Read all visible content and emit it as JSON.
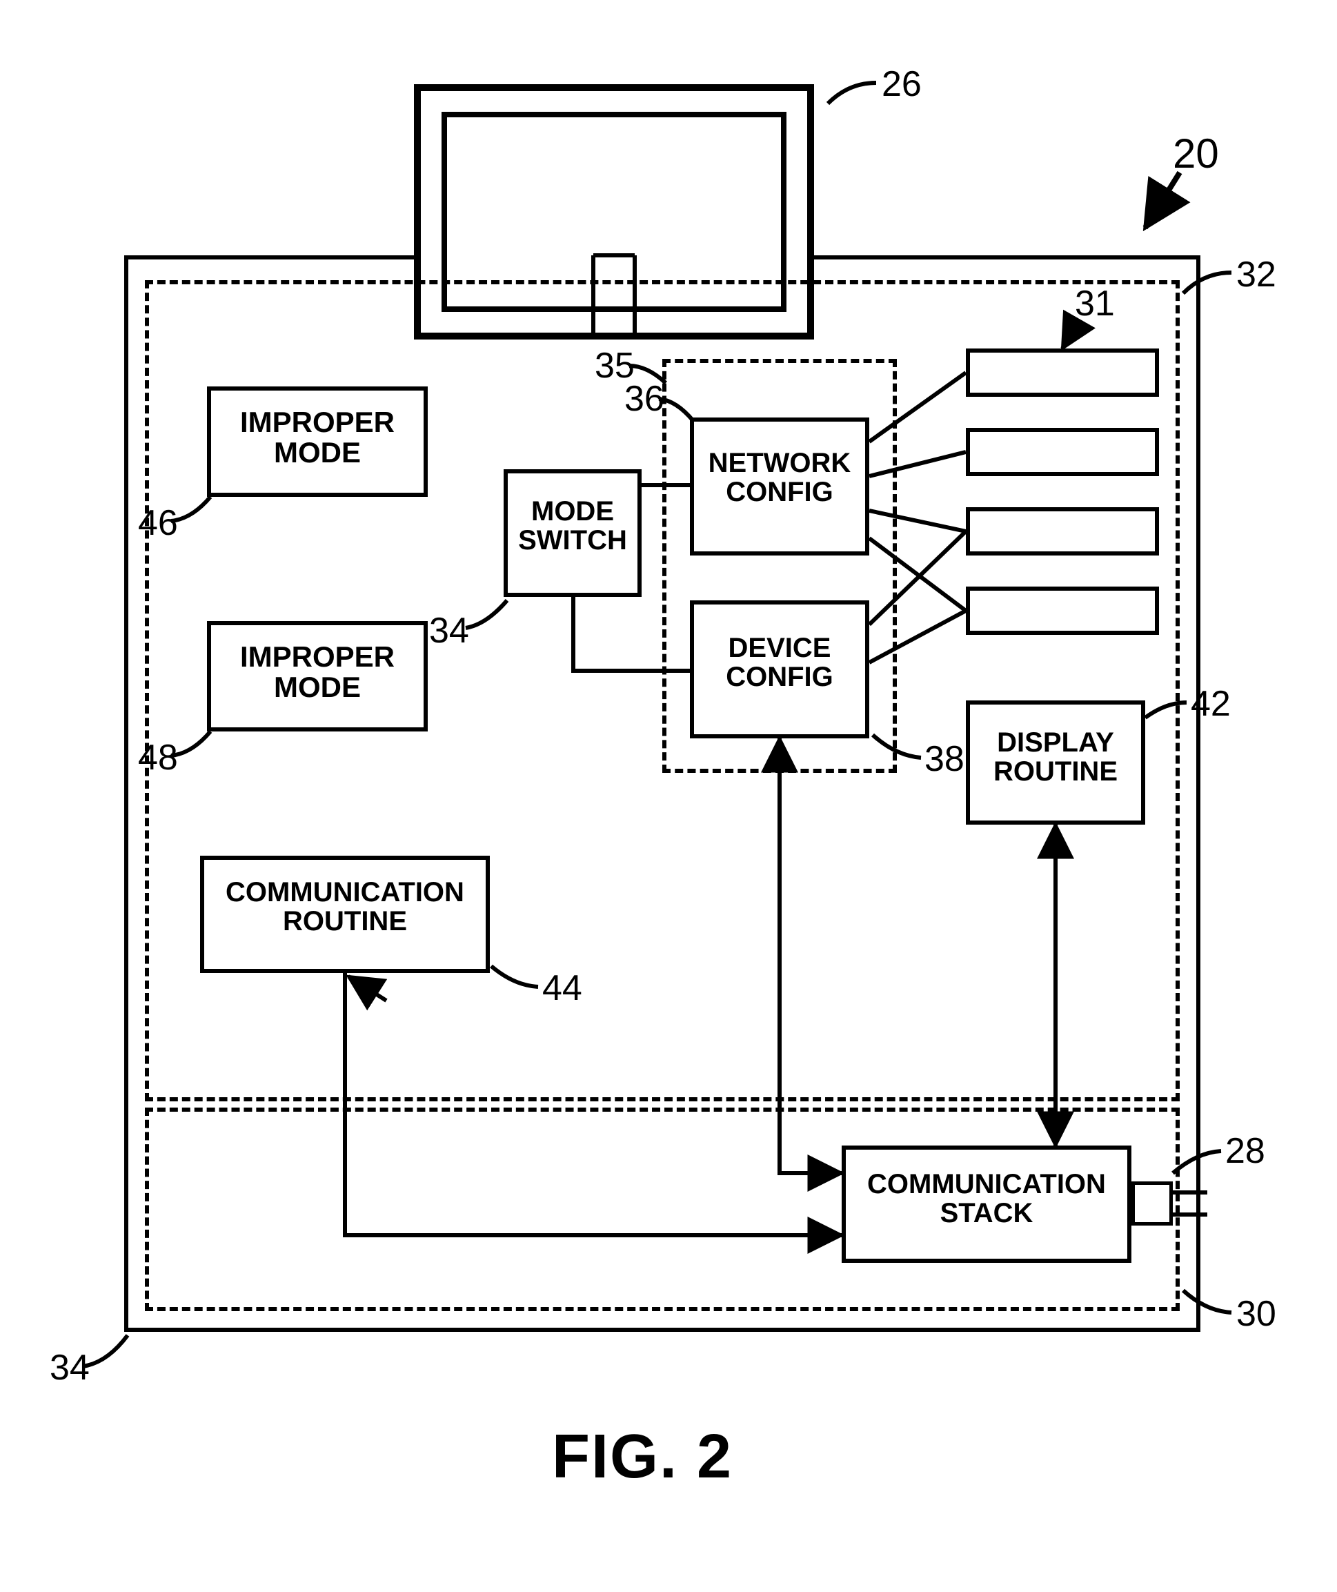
{
  "figure_label": "FIG. 2",
  "refs": {
    "r20": "20",
    "r26": "26",
    "r28": "28",
    "r30": "30",
    "r31": "31",
    "r32": "32",
    "r34a": "34",
    "r34b": "34",
    "r35": "35",
    "r36": "36",
    "r38": "38",
    "r42": "42",
    "r44": "44",
    "r46": "46",
    "r48": "48"
  },
  "blocks": {
    "improper_mode_1": "IMPROPER\nMODE",
    "improper_mode_2": "IMPROPER\nMODE",
    "communication_routine": "COMMUNICATION\nROUTINE",
    "mode_switch": "MODE\nSWITCH",
    "network_config": "NETWORK\nCONFIG",
    "device_config": "DEVICE\nCONFIG",
    "display_routine": "DISPLAY\nROUTINE",
    "communication_stack": "COMMUNICATION\nSTACK"
  }
}
